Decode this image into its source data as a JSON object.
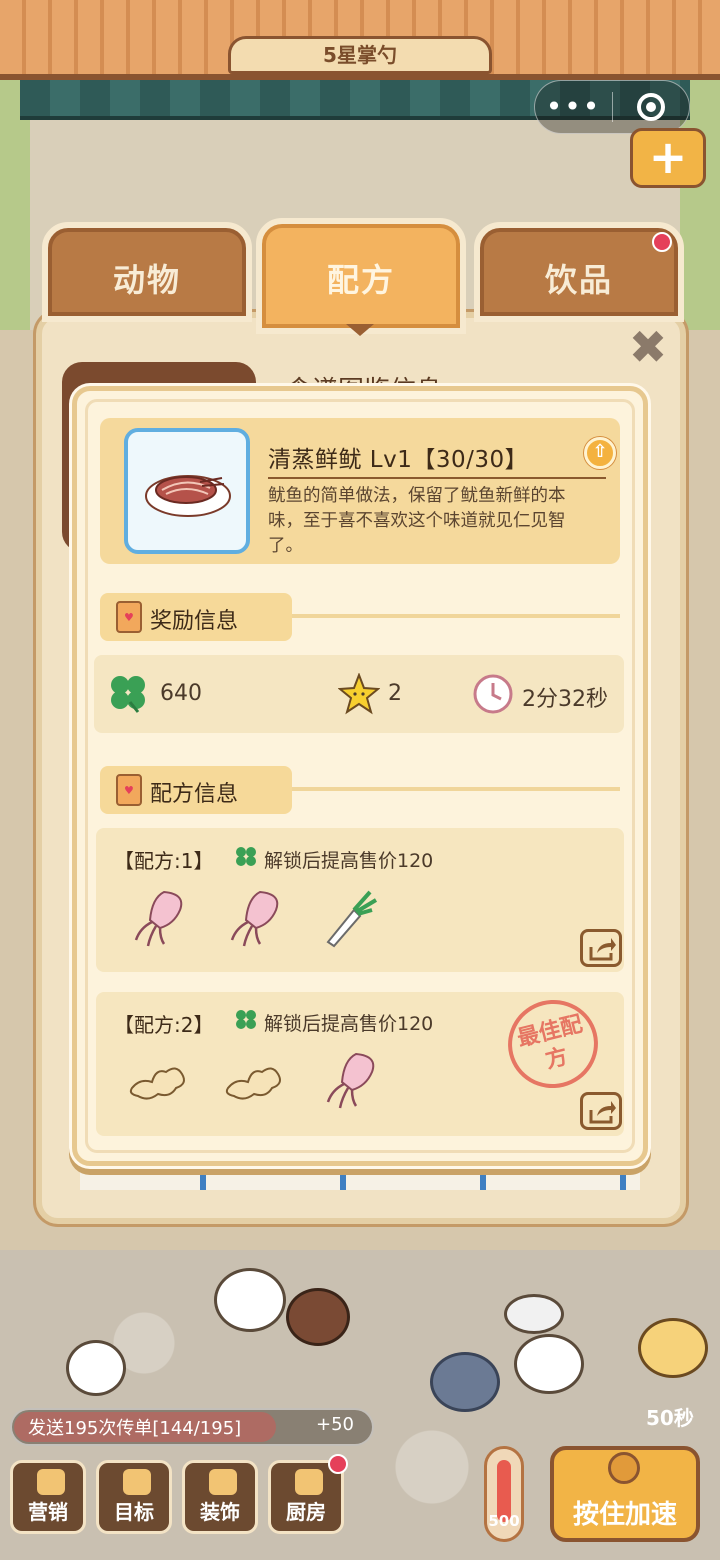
{
  "shop": {
    "sign": "5星掌勺"
  },
  "tabs": [
    {
      "label": "动物"
    },
    {
      "label": "配方"
    },
    {
      "label": "饮品"
    }
  ],
  "panel": {
    "heading": "食谱图鉴信息"
  },
  "dish": {
    "title": "清蒸鲜鱿 Lv1【30/30】",
    "description": "鱿鱼的简单做法，保留了鱿鱼新鲜的本味，至于喜不喜欢这个味道就见仁见智了。"
  },
  "reward_section": {
    "label": "奖励信息",
    "clover": "640",
    "stars": "2",
    "time": "2分32秒"
  },
  "recipe_section": {
    "label": "配方信息",
    "recipes": [
      {
        "label": "【配方:1】",
        "note": "解锁后提高售价120",
        "ingredients": [
          "squid-icon",
          "squid-icon",
          "leek-icon"
        ]
      },
      {
        "label": "【配方:2】",
        "note": "解锁后提高售价120",
        "ingredients": [
          "ginger-icon",
          "ginger-icon",
          "squid-icon"
        ],
        "stamp": "最佳配方"
      }
    ]
  },
  "hud": {
    "quest": "发送195次传单[144/195]",
    "quest_reward": "+50",
    "buttons": [
      {
        "label": "营销"
      },
      {
        "label": "目标"
      },
      {
        "label": "装饰"
      },
      {
        "label": "厨房"
      }
    ],
    "heat": "500",
    "speed_button": "按住加速",
    "timer": "50秒"
  },
  "colors": {
    "accent": "#f2b446",
    "tab_inactive": "#b87a45",
    "modal_bg": "#fdf3dc",
    "clover": "#3aa055",
    "star": "#f7cf2f",
    "stamp": "#e56a5a"
  }
}
